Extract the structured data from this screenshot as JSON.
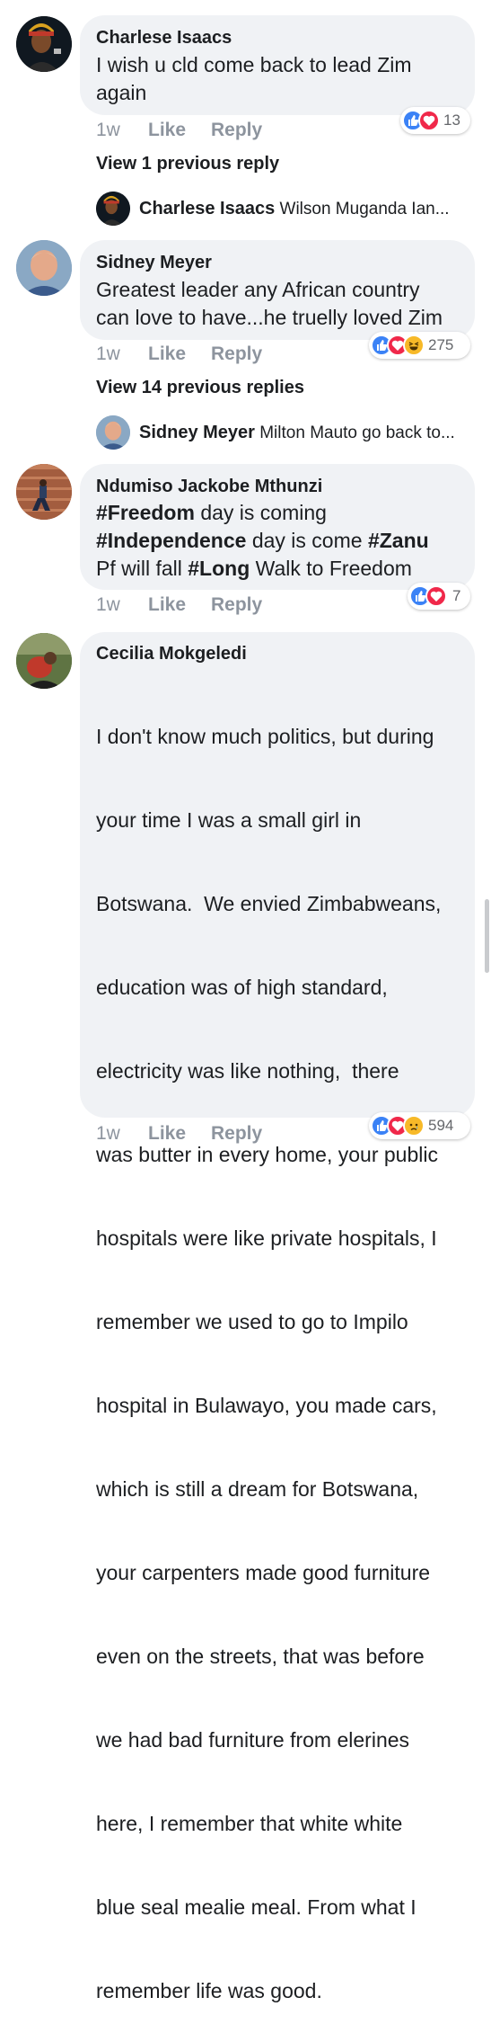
{
  "comments": [
    {
      "name": "Charlese Isaacs",
      "text_lines": [
        "I wish u cld come back to lead Zim",
        "again"
      ],
      "time": "1w",
      "like": "Like",
      "reply": "Reply",
      "reaction_count": "13",
      "view_replies": "View 1 previous reply",
      "last_reply": {
        "name": "Charlese Isaacs",
        "text": "Wilson Muganda  Ian..."
      }
    },
    {
      "name": "Sidney Meyer",
      "text_lines": [
        "Greatest leader any African country",
        "can love to have...he truelly loved Zim"
      ],
      "time": "1w",
      "like": "Like",
      "reply": "Reply",
      "reaction_count": "275",
      "view_replies": "View 14 previous replies",
      "last_reply": {
        "name": "Sidney Meyer",
        "text": "Milton Mauto go back to..."
      }
    },
    {
      "name": "Ndumiso Jackobe Mthunzi",
      "text_parts": [
        {
          "tag": "#Freedom",
          "rest": " day is coming"
        },
        {
          "tag": "#Independence",
          "rest": " day is come ",
          "tag2": "#Zanu"
        },
        {
          "pre": "Pf will fall ",
          "tag": "#Long",
          "rest": " Walk to Freedom"
        }
      ],
      "time": "1w",
      "like": "Like",
      "reply": "Reply",
      "reaction_count": "7"
    },
    {
      "name": "Cecilia Mokgeledi",
      "text_lines": [
        "I don't know much politics, but during",
        "your time I was a small girl in",
        "Botswana.  We envied Zimbabweans,",
        "education was of high standard,",
        "electricity was like nothing,  there",
        "was butter in every home, your public",
        "hospitals were like private hospitals, I",
        "remember we used to go to Impilo",
        "hospital in Bulawayo, you made cars,",
        "which is still a dream for Botswana,",
        "your carpenters made good furniture",
        "even on the streets, that was before",
        "we had bad furniture from elerines",
        "here, I remember that white white",
        "blue seal mealie meal. From what I",
        "remember life was good."
      ],
      "time": "1w",
      "like": "Like",
      "reply": "Reply",
      "reaction_count": "594"
    }
  ],
  "colors": {
    "like_blue": "#3b82f6",
    "love_red": "#f0284a",
    "haha_yellow": "#f7b928",
    "bubble": "#f0f2f5",
    "meta_gray": "#8d949e"
  },
  "icons": [
    "like-icon",
    "love-icon",
    "haha-icon",
    "sad-icon"
  ]
}
